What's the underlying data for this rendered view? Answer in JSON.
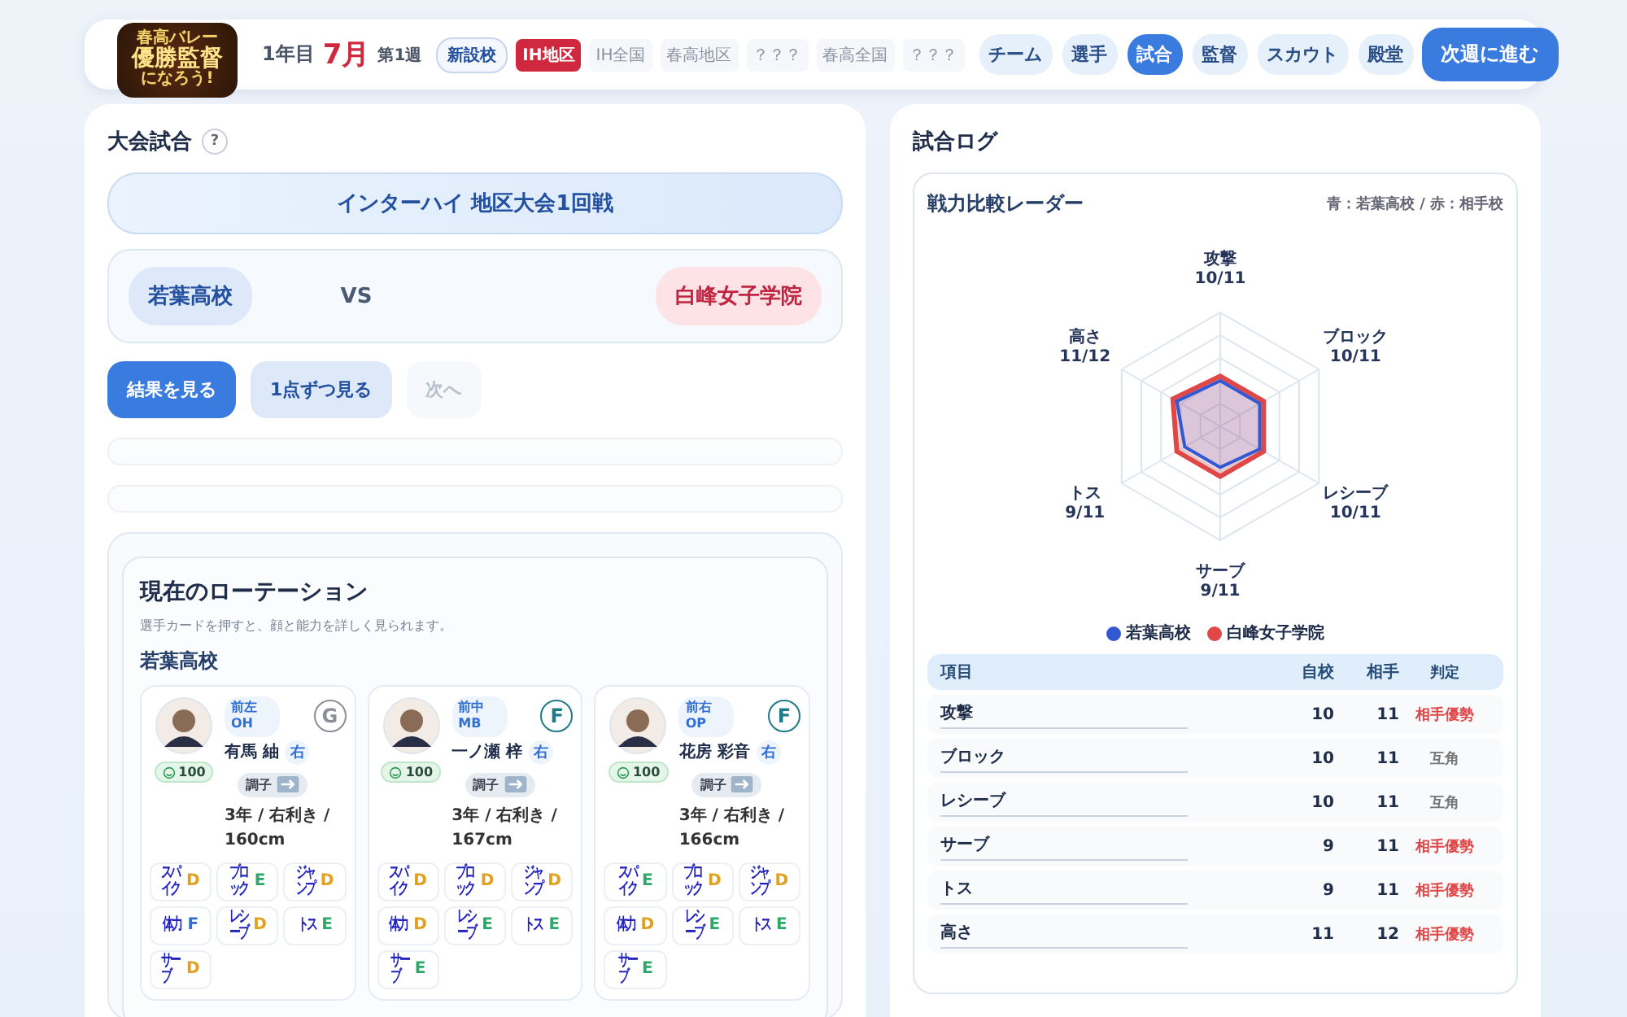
{
  "header": {
    "logo": [
      "春高バレー",
      "優勝監督",
      "になろう!"
    ],
    "year": "1年目",
    "month": "7月",
    "week": "第1週",
    "school_badge": "新設校",
    "stages": [
      {
        "label": "IH地区",
        "selected": true
      },
      {
        "label": "IH全国",
        "selected": false
      },
      {
        "label": "春高地区",
        "selected": false
      },
      {
        "label": "？？？",
        "selected": false
      },
      {
        "label": "春高全国",
        "selected": false
      },
      {
        "label": "？？？",
        "selected": false
      }
    ],
    "nav": [
      {
        "label": "チーム",
        "selected": false
      },
      {
        "label": "選手",
        "selected": false
      },
      {
        "label": "試合",
        "selected": true
      },
      {
        "label": "監督",
        "selected": false
      },
      {
        "label": "スカウト",
        "selected": false
      },
      {
        "label": "殿堂",
        "selected": false
      }
    ],
    "next_button": "次週に進む"
  },
  "match": {
    "title": "大会試合",
    "help": "?",
    "banner": "インターハイ 地区大会1回戦",
    "home": "若葉高校",
    "vs": "VS",
    "away": "白峰女子学院",
    "buttons": [
      {
        "label": "結果を見る",
        "kind": "primary",
        "disabled": false
      },
      {
        "label": "1点ずつ見る",
        "kind": "secondary",
        "disabled": false
      },
      {
        "label": "次へ",
        "kind": "secondary",
        "disabled": true
      }
    ]
  },
  "rotation": {
    "title": "現在のローテーション",
    "hint": "選手カードを押すと、顔と能力を詳しく見られます。",
    "team": "若葉高校",
    "players": [
      {
        "slot": "前左",
        "position": "OH",
        "rank": "G",
        "color": "#8a8f98",
        "stamina": "100",
        "name": "有馬 紬",
        "hand": "右",
        "condition": "調子",
        "info": "3年 / 右利き / 160cm",
        "skills": [
          {
            "label": "スパイク",
            "grade": "D",
            "color": "#e0a020"
          },
          {
            "label": "ブロック",
            "grade": "E",
            "color": "#2ea86a"
          },
          {
            "label": "ジャンプ",
            "grade": "D",
            "color": "#e0a020"
          },
          {
            "label": "体力",
            "grade": "F",
            "color": "#2f6fd6"
          },
          {
            "label": "レシーブ",
            "grade": "D",
            "color": "#e0a020"
          },
          {
            "label": "トス",
            "grade": "E",
            "color": "#2ea86a"
          },
          {
            "label": "サーブ",
            "grade": "D",
            "color": "#e0a020"
          }
        ]
      },
      {
        "slot": "前中",
        "position": "MB",
        "rank": "F",
        "color": "#1f7a8c",
        "stamina": "100",
        "name": "一ノ瀬 梓",
        "hand": "右",
        "condition": "調子",
        "info": "3年 / 右利き / 167cm",
        "skills": [
          {
            "label": "スパイク",
            "grade": "D",
            "color": "#e0a020"
          },
          {
            "label": "ブロック",
            "grade": "D",
            "color": "#e0a020"
          },
          {
            "label": "ジャンプ",
            "grade": "D",
            "color": "#e0a020"
          },
          {
            "label": "体力",
            "grade": "D",
            "color": "#e0a020"
          },
          {
            "label": "レシーブ",
            "grade": "E",
            "color": "#2ea86a"
          },
          {
            "label": "トス",
            "grade": "E",
            "color": "#2ea86a"
          },
          {
            "label": "サーブ",
            "grade": "E",
            "color": "#2ea86a"
          }
        ]
      },
      {
        "slot": "前右",
        "position": "OP",
        "rank": "F",
        "color": "#1f7a8c",
        "stamina": "100",
        "name": "花房 彩音",
        "hand": "右",
        "condition": "調子",
        "info": "3年 / 右利き / 166cm",
        "skills": [
          {
            "label": "スパイク",
            "grade": "E",
            "color": "#2ea86a"
          },
          {
            "label": "ブロック",
            "grade": "D",
            "color": "#e0a020"
          },
          {
            "label": "ジャンプ",
            "grade": "D",
            "color": "#e0a020"
          },
          {
            "label": "体力",
            "grade": "D",
            "color": "#e0a020"
          },
          {
            "label": "レシーブ",
            "grade": "E",
            "color": "#2ea86a"
          },
          {
            "label": "トス",
            "grade": "E",
            "color": "#2ea86a"
          },
          {
            "label": "サーブ",
            "grade": "E",
            "color": "#2ea86a"
          }
        ]
      }
    ]
  },
  "log": {
    "title": "試合ログ",
    "radar": {
      "title": "戦力比較レーダー",
      "note": "青：若葉高校 / 赤：相手校",
      "axes": [
        {
          "label": "攻撃",
          "value": "10/11"
        },
        {
          "label": "ブロック",
          "value": "10/11"
        },
        {
          "label": "レシーブ",
          "value": "10/11"
        },
        {
          "label": "サーブ",
          "value": "9/11"
        },
        {
          "label": "トス",
          "value": "9/11"
        },
        {
          "label": "高さ",
          "value": "11/12"
        }
      ],
      "legend": [
        {
          "label": "若葉高校",
          "color": "#3358d4"
        },
        {
          "label": "白峰女子学院",
          "color": "#e04848"
        }
      ]
    },
    "table": {
      "columns": [
        "項目",
        "自校",
        "相手",
        "判定"
      ],
      "rows": [
        {
          "item": "攻撃",
          "own": "10",
          "opp": "11",
          "verdict": "相手優勢",
          "kind": "opponent"
        },
        {
          "item": "ブロック",
          "own": "10",
          "opp": "11",
          "verdict": "互角",
          "kind": "even"
        },
        {
          "item": "レシーブ",
          "own": "10",
          "opp": "11",
          "verdict": "互角",
          "kind": "even"
        },
        {
          "item": "サーブ",
          "own": "9",
          "opp": "11",
          "verdict": "相手優勢",
          "kind": "opponent"
        },
        {
          "item": "トス",
          "own": "9",
          "opp": "11",
          "verdict": "相手優勢",
          "kind": "opponent"
        },
        {
          "item": "高さ",
          "own": "11",
          "opp": "12",
          "verdict": "相手優勢",
          "kind": "opponent"
        }
      ]
    }
  }
}
